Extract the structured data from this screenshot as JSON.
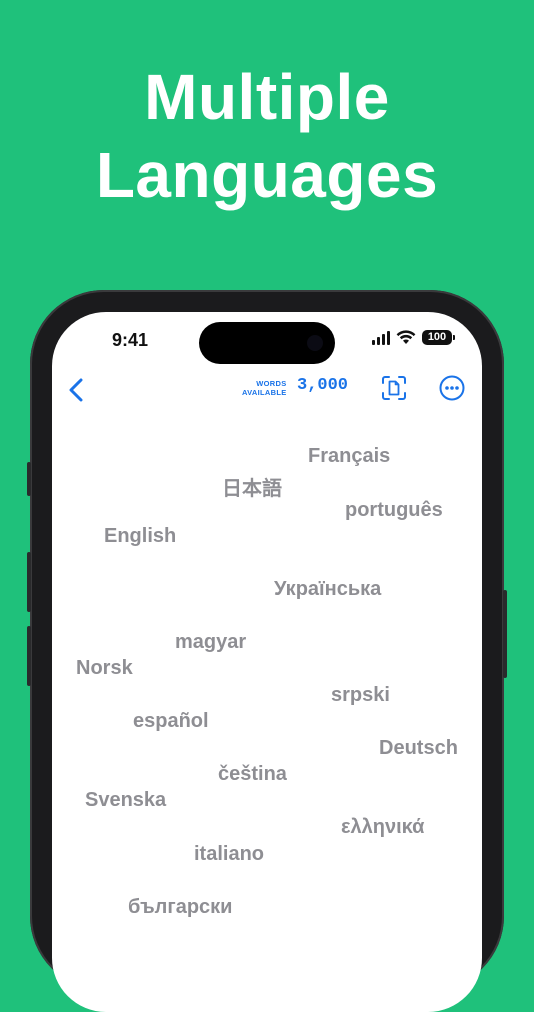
{
  "theme": {
    "background": "#1fc17b",
    "accent": "#1a73e8",
    "word_color": "#8e8e93"
  },
  "headline": {
    "line1": "Multiple",
    "line2": "Languages"
  },
  "status_bar": {
    "time": "9:41",
    "battery": "100"
  },
  "navbar": {
    "words_label_1": "WORDS",
    "words_label_2": "AVAILABLE",
    "words_count": "3,000"
  },
  "languages": [
    "Français",
    "日本語",
    "português",
    "English",
    "Українська",
    "magyar",
    "Norsk",
    "srpski",
    "español",
    "Deutsch",
    "čeština",
    "Svenska",
    "ελληνικά",
    "italiano",
    "български"
  ]
}
